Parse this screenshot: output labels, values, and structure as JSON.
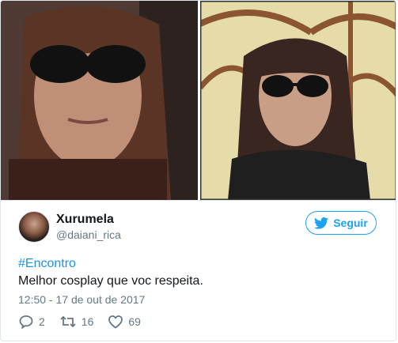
{
  "tweet": {
    "display_name": "Xurumela",
    "handle": "@daiani_rica",
    "follow_label": "Seguir",
    "hashtag": "#Encontro",
    "text": "Melhor cosplay que voc respeita.",
    "timestamp": "12:50 - 17 de out de 2017",
    "replies": "2",
    "retweets": "16",
    "likes": "69"
  },
  "colors": {
    "accent": "#1da1f2",
    "muted": "#657786",
    "text": "#14171a"
  },
  "icons": {
    "follow": "twitter-bird-icon",
    "reply": "reply-icon",
    "retweet": "retweet-icon",
    "like": "heart-icon"
  }
}
